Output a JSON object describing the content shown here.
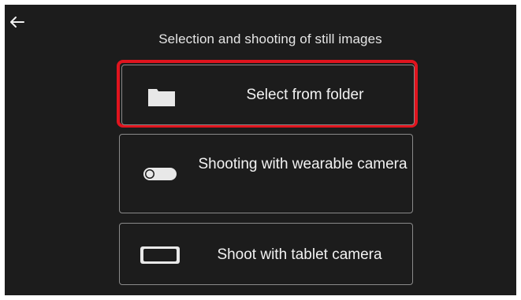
{
  "header": {
    "back_icon": "arrow-left-icon",
    "title": "Selection and shooting of still images"
  },
  "options": [
    {
      "label": "Select from folder",
      "icon": "folder-icon",
      "highlighted": true
    },
    {
      "label": "Shooting with wearable camera",
      "icon": "wearable-camera-icon",
      "highlighted": false
    },
    {
      "label": "Shoot with tablet camera",
      "icon": "tablet-icon",
      "highlighted": false
    }
  ],
  "colors": {
    "background": "#1c1c1c",
    "highlight": "#e0141e",
    "text": "#f2f2f2",
    "border": "#8a8a8a"
  }
}
